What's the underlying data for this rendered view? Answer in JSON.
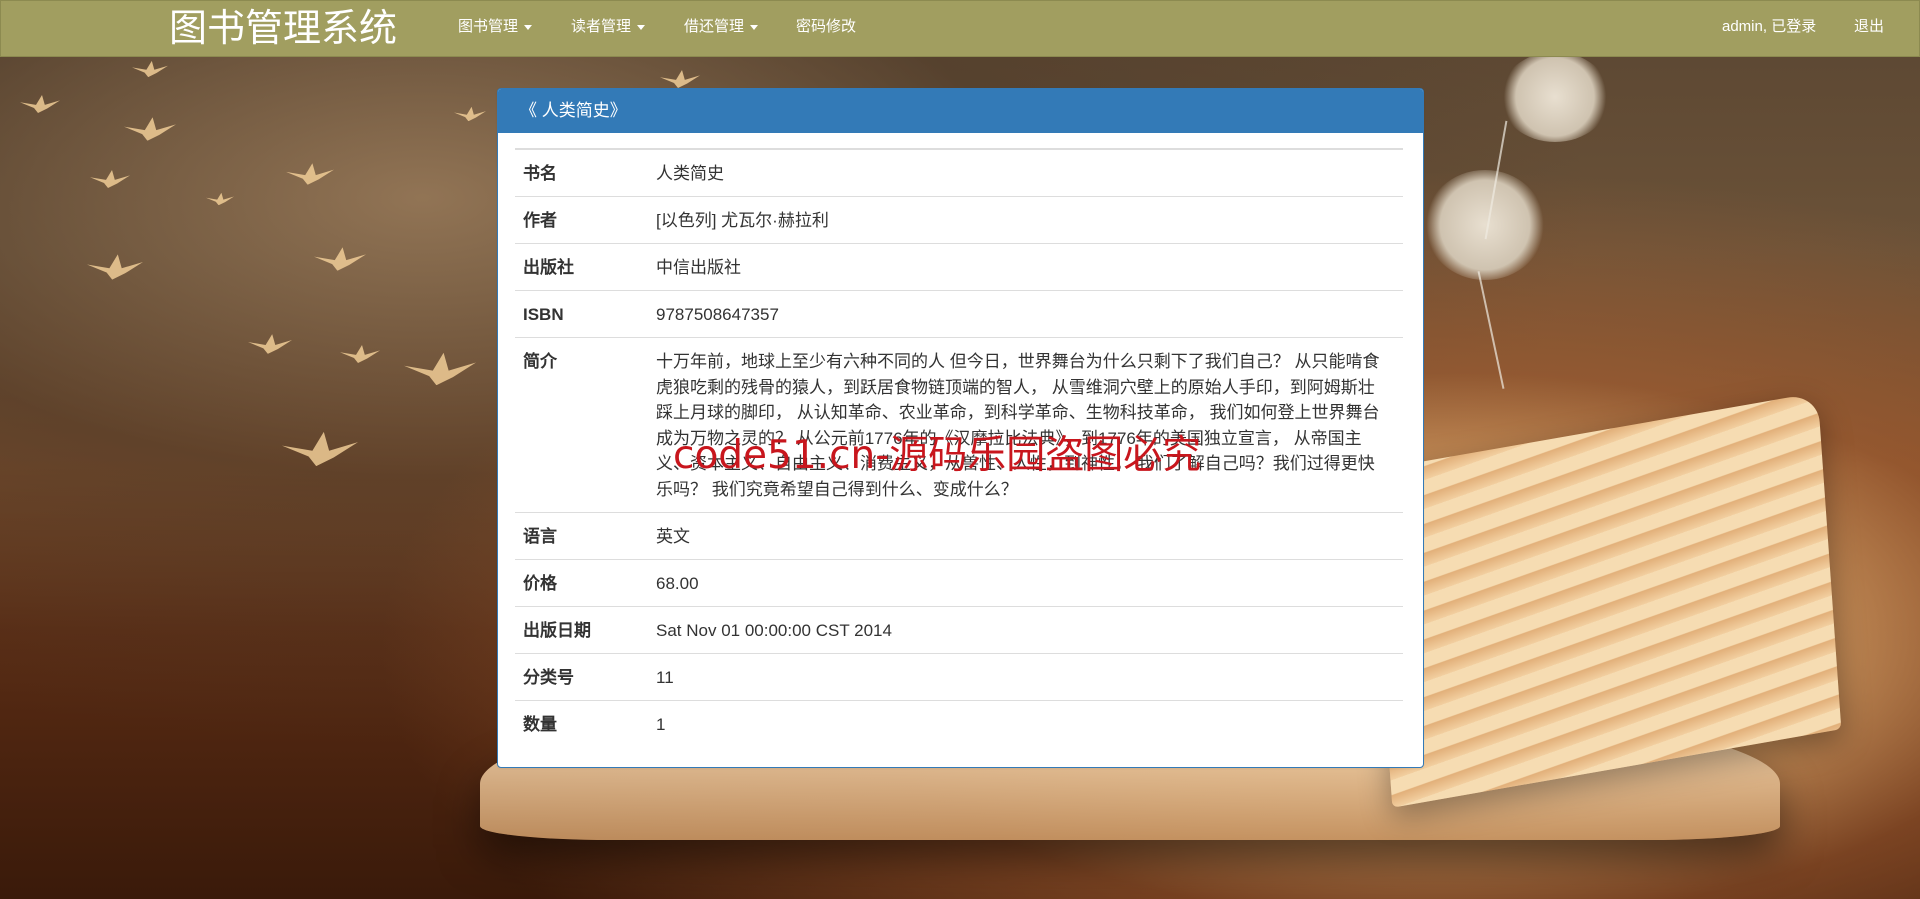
{
  "app": {
    "brand": "图书管理系统"
  },
  "nav": {
    "items": [
      {
        "label": "图书管理",
        "dropdown": true
      },
      {
        "label": "读者管理",
        "dropdown": true
      },
      {
        "label": "借还管理",
        "dropdown": true
      },
      {
        "label": "密码修改",
        "dropdown": false
      }
    ],
    "user_status": "admin, 已登录",
    "logout_label": "退出"
  },
  "panel": {
    "title": "《 人类简史》",
    "rows": [
      {
        "label": "书名",
        "value": "人类简史"
      },
      {
        "label": "作者",
        "value": "[以色列] 尤瓦尔·赫拉利"
      },
      {
        "label": "出版社",
        "value": "中信出版社"
      },
      {
        "label": "ISBN",
        "value": "9787508647357"
      },
      {
        "label": "简介",
        "value": "十万年前，地球上至少有六种不同的人 但今日，世界舞台为什么只剩下了我们自己？ 从只能啃食虎狼吃剩的残骨的猿人，到跃居食物链顶端的智人， 从雪维洞穴壁上的原始人手印，到阿姆斯壮踩上月球的脚印， 从认知革命、农业革命，到科学革命、生物科技革命， 我们如何登上世界舞台成为万物之灵的？ 从公元前1776年的《汉摩拉比法典》，到1776年的美国独立宣言， 从帝国主义、资本主义、自由主义、消费主义，从兽性、人性，到神性， 我们了解自己吗？我们过得更快乐吗？ 我们究竟希望自己得到什么、变成什么？"
      },
      {
        "label": "语言",
        "value": "英文"
      },
      {
        "label": "价格",
        "value": "68.00"
      },
      {
        "label": "出版日期",
        "value": "Sat Nov 01 00:00:00 CST 2014"
      },
      {
        "label": "分类号",
        "value": "11"
      },
      {
        "label": "数量",
        "value": "1"
      }
    ]
  },
  "watermark": "code51.cn-源码乐园盗图必究",
  "colors": {
    "navbar": "#a19e60",
    "panel_primary": "#337ab7",
    "watermark": "#c8161d"
  }
}
